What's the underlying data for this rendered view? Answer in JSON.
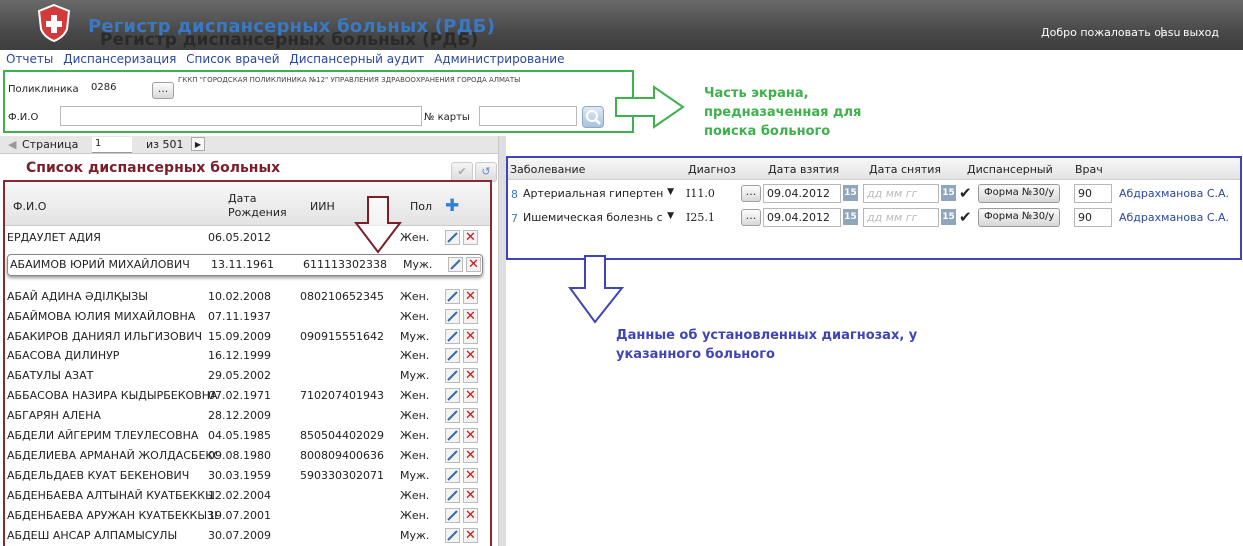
{
  "header": {
    "title": "Регистр диспансерных больных (РДБ)",
    "title_shadow": "Регистр диспансерных больных (РДБ)",
    "welcome": "Добро пожаловать oasu",
    "separator": "|",
    "exit": "выход"
  },
  "menu": [
    "Отчеты",
    "Диспансеризация",
    "Список врачей",
    "Диспансерный аудит",
    "Администрирование"
  ],
  "search": {
    "clinic_label": "Поликлиника",
    "clinic_code": "0286",
    "dots": "...",
    "clinic_name": "ГККП \"ГОРОДСКАЯ ПОЛИКЛИНИКА №12\" УПРАВЛЕНИЯ ЗДРАВООХРАНЕНИЯ ГОРОДА АЛМАТЫ",
    "fio_label": "Ф.И.О",
    "fio_value": "",
    "card_label": "№ карты",
    "card_value": ""
  },
  "pager": {
    "page_label": "Страница",
    "page": "1",
    "of_text": "из 501"
  },
  "annotations": {
    "green": [
      "Часть экрана,",
      "предназаченная для",
      "поиска больного"
    ],
    "red": "Список диспансерных больных",
    "blue": [
      "Данные об установленных диагнозах, у",
      "указанного больного"
    ]
  },
  "patients": {
    "columns": {
      "fio": "Ф.И.О",
      "dob": "Дата Рождения",
      "iin": "ИИН",
      "sex": "Пол"
    },
    "rows": [
      {
        "fio": "ЕРДАУЛЕТ АДИЯ",
        "dob": "06.05.2012",
        "iin": "",
        "sex": "Жен."
      },
      {
        "fio": "АБАИМОВ ЮРИЙ МИХАЙЛОВИЧ",
        "dob": "13.11.1961",
        "iin": "611113302338",
        "sex": "Муж."
      },
      {
        "fio": "АБАЙ АДИНА ӘДІЛҚЫЗЫ",
        "dob": "10.02.2008",
        "iin": "080210652345",
        "sex": "Жен."
      },
      {
        "fio": "АБАЙМОВА ЮЛИЯ МИХАЙЛОВНА",
        "dob": "07.11.1937",
        "iin": "",
        "sex": "Жен."
      },
      {
        "fio": "АБАКИРОВ ДАНИЯЛ ИЛЬГИЗОВИЧ",
        "dob": "15.09.2009",
        "iin": "090915551642",
        "sex": "Муж."
      },
      {
        "fio": "АБАСОВА ДИЛИНУР",
        "dob": "16.12.1999",
        "iin": "",
        "sex": "Жен."
      },
      {
        "fio": "АБАТУЛЫ АЗАТ",
        "dob": "29.05.2002",
        "iin": "",
        "sex": "Муж."
      },
      {
        "fio": "АББАСОВА НАЗИРА КЫДЫРБЕКОВНА",
        "dob": "07.02.1971",
        "iin": "710207401943",
        "sex": "Жен."
      },
      {
        "fio": "АБГАРЯН АЛЕНА",
        "dob": "28.12.2009",
        "iin": "",
        "sex": "Жен."
      },
      {
        "fio": "АБДЕЛИ АЙГЕРИМ ТЛЕУЛЕСОВНА",
        "dob": "04.05.1985",
        "iin": "850504402029",
        "sex": "Жен."
      },
      {
        "fio": "АБДЕЛИЕВА АРМАНАЙ ЖОЛДАСБЕКО",
        "dob": "09.08.1980",
        "iin": "800809400636",
        "sex": "Жен."
      },
      {
        "fio": "АБДЕЛЬДАЕВ КУАТ БЕКЕНОВИЧ",
        "dob": "30.03.1959",
        "iin": "590330302071",
        "sex": "Муж."
      },
      {
        "fio": "АБДЕНБАЕВА АЛТЫНАЙ КУАТБЕККЫЗ",
        "dob": "12.02.2004",
        "iin": "",
        "sex": "Жен."
      },
      {
        "fio": "АБДЕНБАЕВА АРУЖАН КУАТБЕККЫЗЬ",
        "dob": "19.07.2001",
        "iin": "",
        "sex": "Жен."
      },
      {
        "fio": "АБДЕШ АНСАР АЛПАМЫСУЛЫ",
        "dob": "30.07.2009",
        "iin": "",
        "sex": "Муж."
      }
    ]
  },
  "diagnoses": {
    "columns": [
      "Заболевание",
      "Диагноз",
      "Дата взятия",
      "Дата снятия",
      "Диспансерный",
      "Врач"
    ],
    "rows": [
      {
        "num": "8",
        "disease": "Артериальная гипертен",
        "code": "I11.0",
        "date_taken": "09.04.2012",
        "date_removed_placeholder": "дд мм гг",
        "cal": "15",
        "form": "Форма №30/у",
        "count": "90",
        "doctor": "Абдрахманова С.А."
      },
      {
        "num": "7",
        "disease": "Ишемическая болезнь с",
        "code": "I25.1",
        "date_taken": "09.04.2012",
        "date_removed_placeholder": "дд мм гг",
        "cal": "15",
        "form": "Форма №30/у",
        "count": "90",
        "doctor": "Абдрахманова С.А."
      }
    ]
  },
  "colors": {
    "header_bg": "#4a4a4a",
    "title": "#3a78c2",
    "menu": "#2a47a0",
    "green": "#3db14a",
    "red_frame": "#8b2732",
    "blue_frame": "#3f45b8"
  }
}
